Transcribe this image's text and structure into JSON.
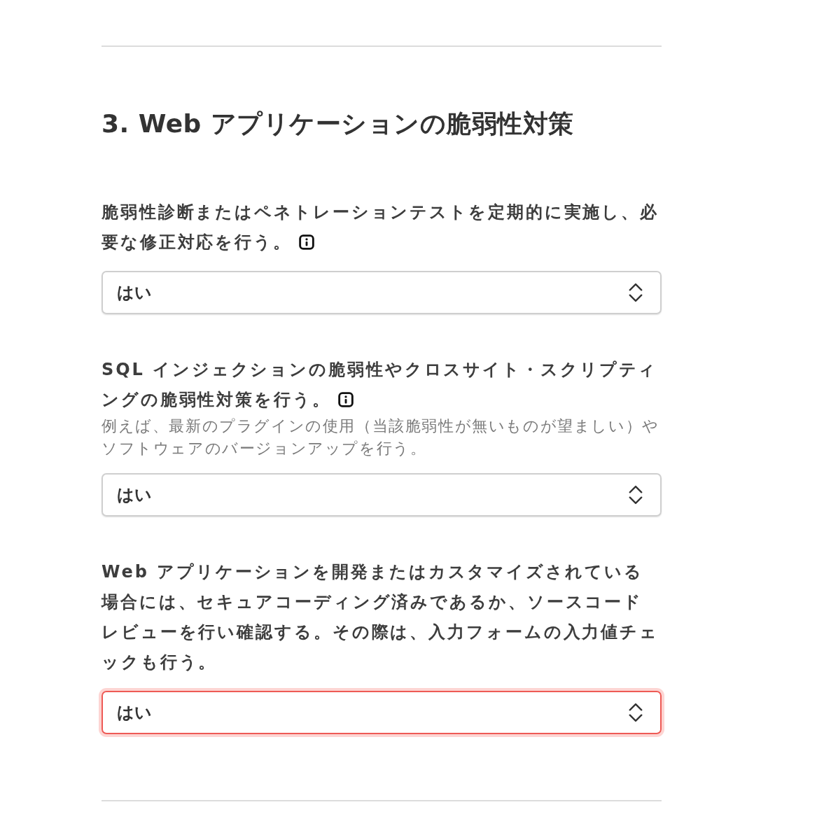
{
  "section": {
    "title": "3. Web アプリケーションの脆弱性対策"
  },
  "questions": [
    {
      "label": "脆弱性診断またはペネトレーションテストを定期的に実施し、必要な修正対応を行う。",
      "has_info": true,
      "select": {
        "value": "はい",
        "focused": false
      }
    },
    {
      "label": "SQL インジェクションの脆弱性やクロスサイト・スクリプティングの脆弱性対策を行う。",
      "has_info": true,
      "hint": "例えば、最新のプラグインの使用（当該脆弱性が無いものが望ましい）やソフトウェアのバージョンアップを行う。",
      "select": {
        "value": "はい",
        "focused": false
      }
    },
    {
      "label": "Web アプリケーションを開発またはカスタマイズされている場合には、セキュアコーディング済みであるか、ソースコードレビューを行い確認する。その際は、入力フォームの入力値チェックも行う。",
      "has_info": false,
      "select": {
        "value": "はい",
        "focused": true
      }
    }
  ]
}
